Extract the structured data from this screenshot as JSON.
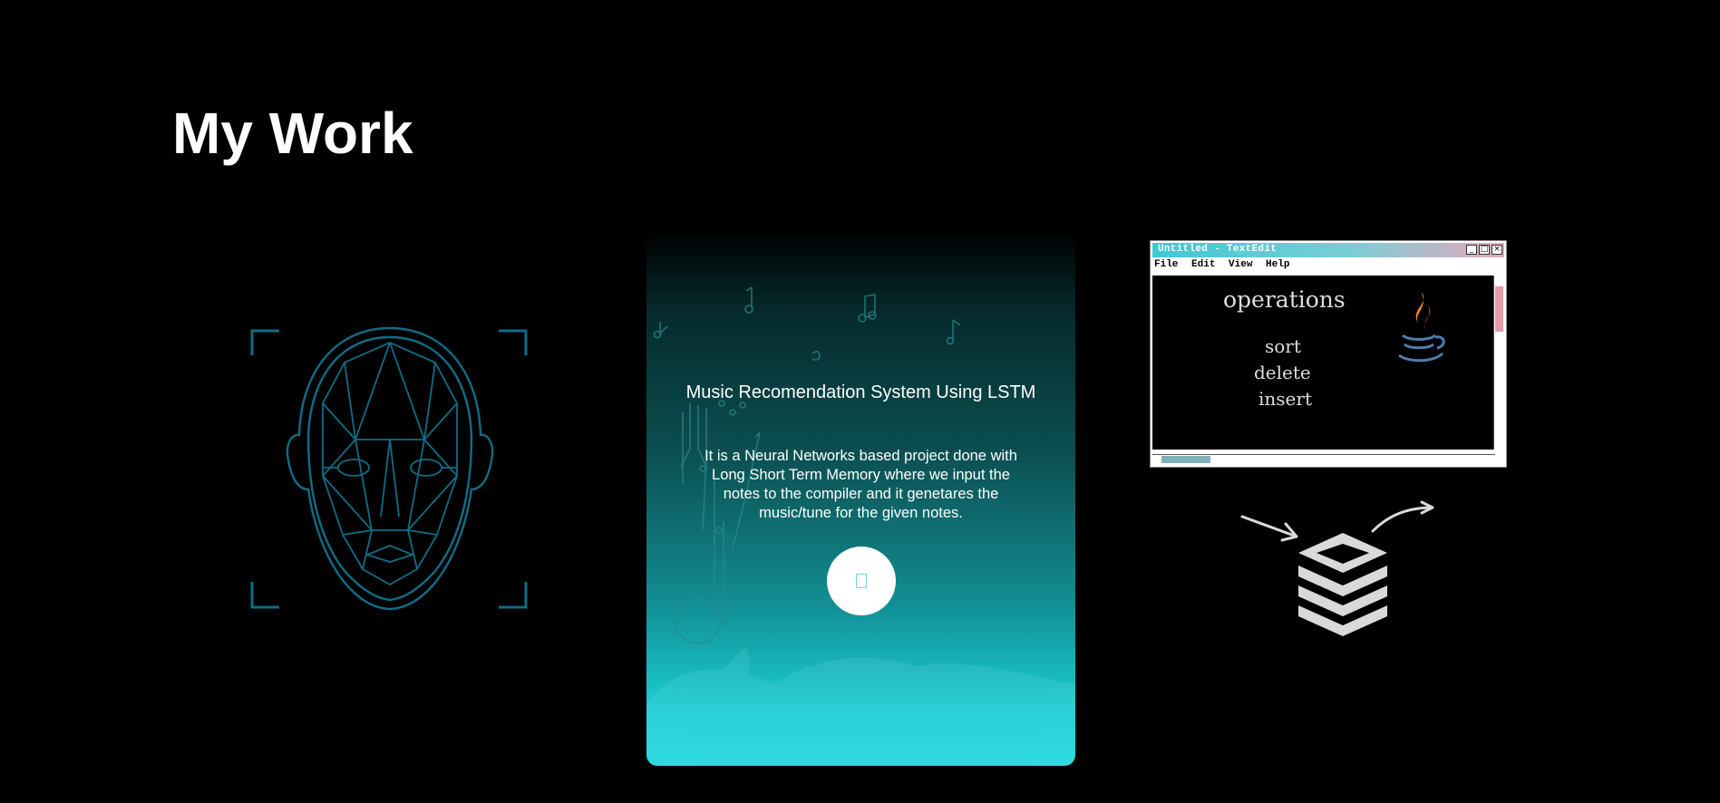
{
  "page": {
    "title": "My Work"
  },
  "cards": {
    "music": {
      "title": "Music Recomendation System Using LSTM",
      "description": "It is a Neural Networks based project done with Long Short Term Memory where we input the notes to the compiler and it genetares the music/tune for the given notes.",
      "button_icon": "external-link-icon"
    },
    "textedit": {
      "window_title": "Untitled - TextEdit",
      "menus": [
        "File",
        "Edit",
        "View",
        "Help"
      ],
      "heading": "operations",
      "items": [
        "sort",
        "delete",
        "insert"
      ]
    }
  },
  "colors": {
    "background": "#000000",
    "accent": "#22dde3",
    "face_line": "#0f6d86"
  }
}
